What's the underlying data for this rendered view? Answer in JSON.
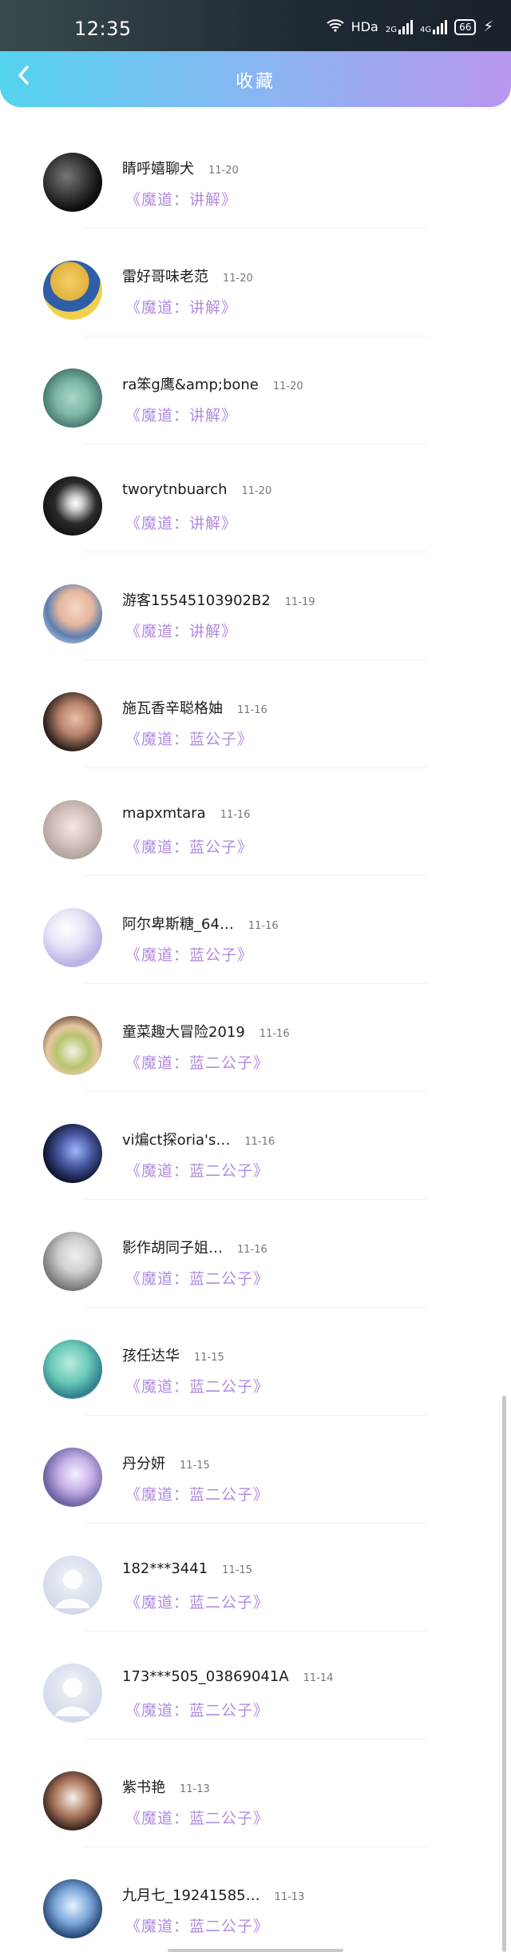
{
  "status_bar": {
    "time": "12:35",
    "icons": [
      "wifi-icon",
      "hd-icon",
      "signal-2g-icon",
      "signal-4g-icon",
      "battery-icon",
      "charging-icon"
    ],
    "hd_text": "HDa",
    "signal_1_label": "2G",
    "signal_2_label": "4G",
    "battery_level": "66"
  },
  "header": {
    "title": "收藏",
    "back_icon": "chevron-left-icon"
  },
  "favorites": [
    {
      "name": "睛呼嬉聊犬",
      "date": "11-20",
      "subtitle": "《魔道：讲解》"
    },
    {
      "name": "雷好哥味老范",
      "date": "11-20",
      "subtitle": "《魔道：讲解》"
    },
    {
      "name": "ra笨g鹰&amp;bone",
      "date": "11-20",
      "subtitle": "《魔道：讲解》"
    },
    {
      "name": "tworytnbuarch",
      "date": "11-20",
      "subtitle": "《魔道：讲解》"
    },
    {
      "name": "游客15545103902B2",
      "date": "11-19",
      "subtitle": "《魔道：讲解》"
    },
    {
      "name": "施瓦香辛聪格妯",
      "date": "11-16",
      "subtitle": "《魔道：蓝公子》"
    },
    {
      "name": "mapxmtara",
      "date": "11-16",
      "subtitle": "《魔道：蓝公子》"
    },
    {
      "name": "阿尔卑斯糖_64…",
      "date": "11-16",
      "subtitle": "《魔道：蓝公子》"
    },
    {
      "name": "童菜趣大冒险2019",
      "date": "11-16",
      "subtitle": "《魔道：蓝二公子》"
    },
    {
      "name": "vi煸ct探oria's…",
      "date": "11-16",
      "subtitle": "《魔道：蓝二公子》"
    },
    {
      "name": "影作胡同子姐…",
      "date": "11-16",
      "subtitle": "《魔道：蓝二公子》"
    },
    {
      "name": "孩任达华",
      "date": "11-15",
      "subtitle": "《魔道：蓝二公子》"
    },
    {
      "name": "丹分妍",
      "date": "11-15",
      "subtitle": "《魔道：蓝二公子》"
    },
    {
      "name": "182***3441",
      "date": "11-15",
      "subtitle": "《魔道：蓝二公子》"
    },
    {
      "name": "173***505_03869041A",
      "date": "11-14",
      "subtitle": "《魔道：蓝二公子》"
    },
    {
      "name": "紫书艳",
      "date": "11-13",
      "subtitle": "《魔道：蓝二公子》"
    },
    {
      "name": "九月七_19241585…",
      "date": "11-13",
      "subtitle": "《魔道：蓝二公子》"
    }
  ],
  "colors": {
    "header_gradient_start": "#54d3ee",
    "header_gradient_end": "#b897ee",
    "subtitle_color": "#b18be0"
  }
}
